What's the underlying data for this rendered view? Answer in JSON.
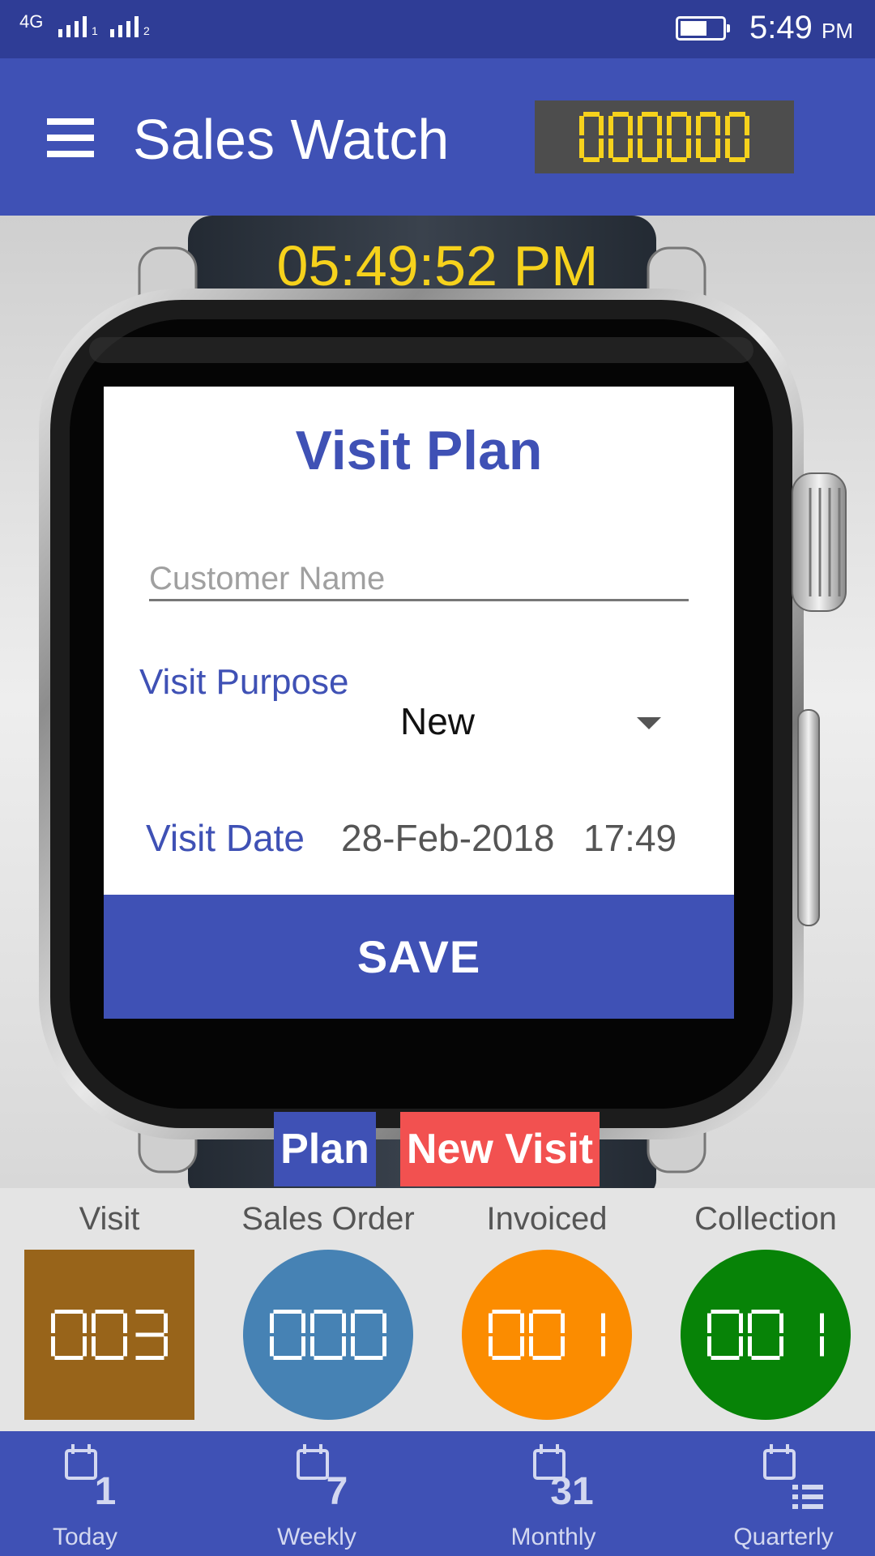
{
  "status_bar": {
    "network": "4G",
    "sim1": "1",
    "sim2": "2",
    "time": "5:49",
    "ampm": "PM"
  },
  "app_bar": {
    "title": "Sales Watch",
    "counter": "000000",
    "counter_color": "#f6d21c"
  },
  "watch": {
    "time": "05:49:52 PM"
  },
  "visit_plan": {
    "title": "Visit Plan",
    "customer_placeholder": "Customer Name",
    "customer_value": "",
    "purpose_label": "Visit Purpose",
    "purpose_value": "New",
    "date_label": "Visit Date",
    "date_value": "28-Feb-2018",
    "time_value": "17:49",
    "save_label": "SAVE"
  },
  "tabs": {
    "plan": "Plan",
    "new_visit": "New Visit"
  },
  "stats": [
    {
      "label": "Visit",
      "value": "003",
      "color": "#98641a",
      "shape": "square"
    },
    {
      "label": "Sales Order",
      "value": "000",
      "color": "#4682b4",
      "shape": "circle"
    },
    {
      "label": "Invoiced",
      "value": "001",
      "color": "#fb8c00",
      "shape": "circle"
    },
    {
      "label": "Collection",
      "value": "001",
      "color": "#078307",
      "shape": "circle"
    }
  ],
  "bottom_nav": [
    {
      "label": "Today",
      "badge": "1",
      "icon": "calendar-day-icon"
    },
    {
      "label": "Weekly",
      "badge": "7",
      "icon": "calendar-week-icon"
    },
    {
      "label": "Monthly",
      "badge": "31",
      "icon": "calendar-month-icon"
    },
    {
      "label": "Quarterly",
      "badge": "",
      "icon": "calendar-list-icon"
    }
  ],
  "colors": {
    "primary": "#3f51b5",
    "status_bar": "#2f3d96",
    "accent_red": "#f25150"
  }
}
